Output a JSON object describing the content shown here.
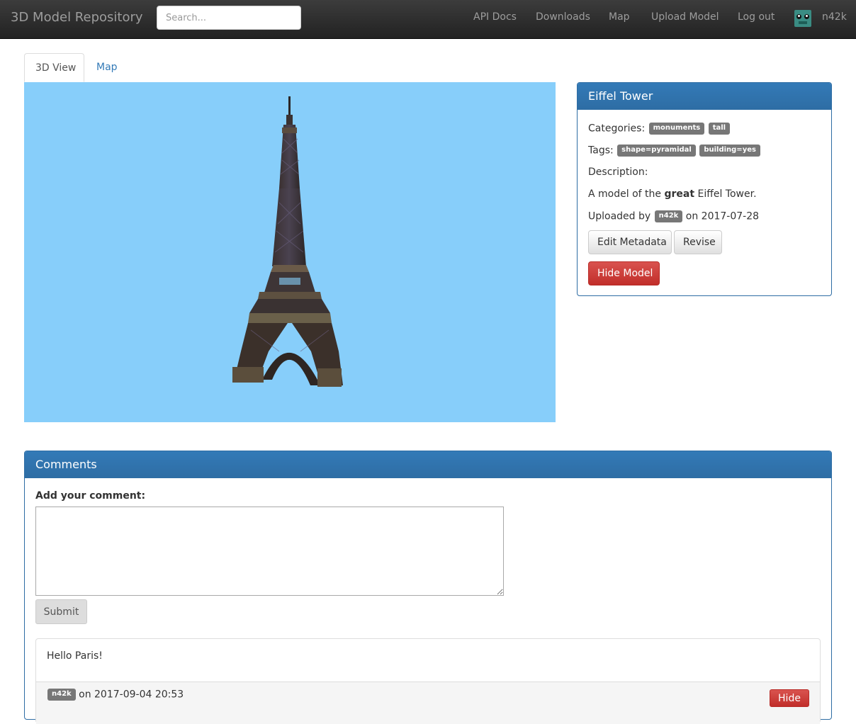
{
  "navbar": {
    "brand": "3D Model Repository",
    "search_placeholder": "Search...",
    "links": [
      "API Docs",
      "Downloads",
      "Map",
      "Upload Model",
      "Log out"
    ],
    "username": "n42k"
  },
  "tabs": [
    {
      "label": "3D View",
      "active": true
    },
    {
      "label": "Map",
      "active": false
    }
  ],
  "viewer": {
    "background": "#87cefa",
    "model_icon": "eiffel-tower-model"
  },
  "model": {
    "title": "Eiffel Tower",
    "categories_label": "Categories:",
    "categories": [
      "monuments",
      "tall"
    ],
    "tags_label": "Tags:",
    "tags": [
      "shape=pyramidal",
      "building=yes"
    ],
    "description_label": "Description:",
    "description_prefix": "A model of the",
    "description_bold": "great",
    "description_suffix": "Eiffel Tower.",
    "uploaded_by_label": "Uploaded by",
    "uploader": "n42k",
    "upload_date_text": "on 2017-07-28",
    "edit_button": "Edit Metadata",
    "revise_button": "Revise",
    "hide_button": "Hide Model"
  },
  "comments": {
    "title": "Comments",
    "add_label": "Add your comment:",
    "submit_button": "Submit",
    "items": [
      {
        "text": "Hello Paris!",
        "author": "n42k",
        "date_text": "on 2017-09-04 20:53",
        "hide_button": "Hide"
      }
    ]
  },
  "colors": {
    "navbar": "#222222",
    "primary": "#337ab7",
    "danger": "#d9534f",
    "label": "#777777",
    "viewer_bg": "#87cefa"
  }
}
